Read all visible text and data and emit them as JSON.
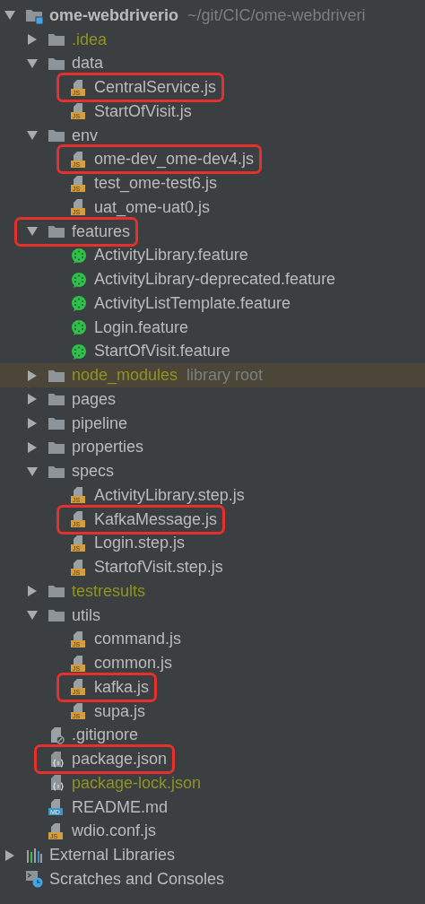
{
  "tree": [
    {
      "name": "ome-webdriverio",
      "hint": "~/git/CIC/ome-webdriveri",
      "kind": "project",
      "expanded": true,
      "ignored": false,
      "boxed": false,
      "shaded": false,
      "children": [
        {
          "name": ".idea",
          "kind": "folder",
          "expanded": false,
          "ignored": true,
          "boxed": false,
          "shaded": false
        },
        {
          "name": "data",
          "kind": "folder",
          "expanded": true,
          "ignored": false,
          "boxed": false,
          "shaded": false,
          "children": [
            {
              "name": "CentralService.js",
              "kind": "js",
              "icon_text": "JS",
              "ignored": false,
              "boxed": true,
              "shaded": false
            },
            {
              "name": "StartOfVisit.js",
              "kind": "js",
              "icon_text": "JS",
              "ignored": false,
              "boxed": false,
              "shaded": false
            }
          ]
        },
        {
          "name": "env",
          "kind": "folder",
          "expanded": true,
          "ignored": false,
          "boxed": false,
          "shaded": false,
          "children": [
            {
              "name": "ome-dev_ome-dev4.js",
              "kind": "js",
              "icon_text": "JS",
              "ignored": false,
              "boxed": true,
              "shaded": false
            },
            {
              "name": "test_ome-test6.js",
              "kind": "js",
              "icon_text": "JS",
              "ignored": false,
              "boxed": false,
              "shaded": false
            },
            {
              "name": "uat_ome-uat0.js",
              "kind": "js",
              "icon_text": "JS",
              "ignored": false,
              "boxed": false,
              "shaded": false
            }
          ]
        },
        {
          "name": "features",
          "kind": "folder",
          "expanded": true,
          "ignored": false,
          "boxed": true,
          "shaded": false,
          "children": [
            {
              "name": "ActivityLibrary.feature",
              "kind": "feature",
              "ignored": false,
              "boxed": false,
              "shaded": false
            },
            {
              "name": "ActivityLibrary-deprecated.feature",
              "kind": "feature",
              "ignored": false,
              "boxed": false,
              "shaded": false
            },
            {
              "name": "ActivityListTemplate.feature",
              "kind": "feature",
              "ignored": false,
              "boxed": false,
              "shaded": false
            },
            {
              "name": "Login.feature",
              "kind": "feature",
              "ignored": false,
              "boxed": false,
              "shaded": false
            },
            {
              "name": "StartOfVisit.feature",
              "kind": "feature",
              "ignored": false,
              "boxed": false,
              "shaded": false
            }
          ]
        },
        {
          "name": "node_modules",
          "hint": "library root",
          "kind": "folder",
          "expanded": false,
          "ignored": true,
          "boxed": false,
          "shaded": true
        },
        {
          "name": "pages",
          "kind": "folder",
          "expanded": false,
          "ignored": false,
          "boxed": false,
          "shaded": false
        },
        {
          "name": "pipeline",
          "kind": "folder",
          "expanded": false,
          "ignored": false,
          "boxed": false,
          "shaded": false
        },
        {
          "name": "properties",
          "kind": "folder",
          "expanded": false,
          "ignored": false,
          "boxed": false,
          "shaded": false
        },
        {
          "name": "specs",
          "kind": "folder",
          "expanded": true,
          "ignored": false,
          "boxed": false,
          "shaded": false,
          "children": [
            {
              "name": "ActivityLibrary.step.js",
              "kind": "js",
              "icon_text": "JS",
              "ignored": false,
              "boxed": false,
              "shaded": false
            },
            {
              "name": "KafkaMessage.js",
              "kind": "js",
              "icon_text": "JS",
              "ignored": false,
              "boxed": true,
              "shaded": false
            },
            {
              "name": "Login.step.js",
              "kind": "js",
              "icon_text": "JS",
              "ignored": false,
              "boxed": false,
              "shaded": false
            },
            {
              "name": "StartofVisit.step.js",
              "kind": "js",
              "icon_text": "JS",
              "ignored": false,
              "boxed": false,
              "shaded": false
            }
          ]
        },
        {
          "name": "testresults",
          "kind": "folder",
          "expanded": false,
          "ignored": true,
          "boxed": false,
          "shaded": false
        },
        {
          "name": "utils",
          "kind": "folder",
          "expanded": true,
          "ignored": false,
          "boxed": false,
          "shaded": false,
          "children": [
            {
              "name": "command.js",
              "kind": "js",
              "icon_text": "JS",
              "ignored": false,
              "boxed": false,
              "shaded": false
            },
            {
              "name": "common.js",
              "kind": "js",
              "icon_text": "JS",
              "ignored": false,
              "boxed": false,
              "shaded": false
            },
            {
              "name": "kafka.js",
              "kind": "js",
              "icon_text": "JS",
              "ignored": false,
              "boxed": true,
              "shaded": false
            },
            {
              "name": "supa.js",
              "kind": "js",
              "icon_text": "JS",
              "ignored": false,
              "boxed": false,
              "shaded": false
            }
          ]
        },
        {
          "name": ".gitignore",
          "kind": "gitignore",
          "ignored": false,
          "boxed": false,
          "shaded": false
        },
        {
          "name": "package.json",
          "kind": "json",
          "ignored": false,
          "boxed": true,
          "shaded": false
        },
        {
          "name": "package-lock.json",
          "kind": "json",
          "ignored": true,
          "boxed": false,
          "shaded": false
        },
        {
          "name": "README.md",
          "kind": "md",
          "icon_text": "MD",
          "ignored": false,
          "boxed": false,
          "shaded": false
        },
        {
          "name": "wdio.conf.js",
          "kind": "js",
          "icon_text": "JS",
          "ignored": false,
          "boxed": false,
          "shaded": false
        }
      ]
    },
    {
      "name": "External Libraries",
      "kind": "libraries",
      "expanded": false,
      "ignored": false,
      "boxed": false,
      "shaded": false
    },
    {
      "name": "Scratches and Consoles",
      "kind": "scratches",
      "ignored": false,
      "boxed": false,
      "shaded": false
    }
  ]
}
